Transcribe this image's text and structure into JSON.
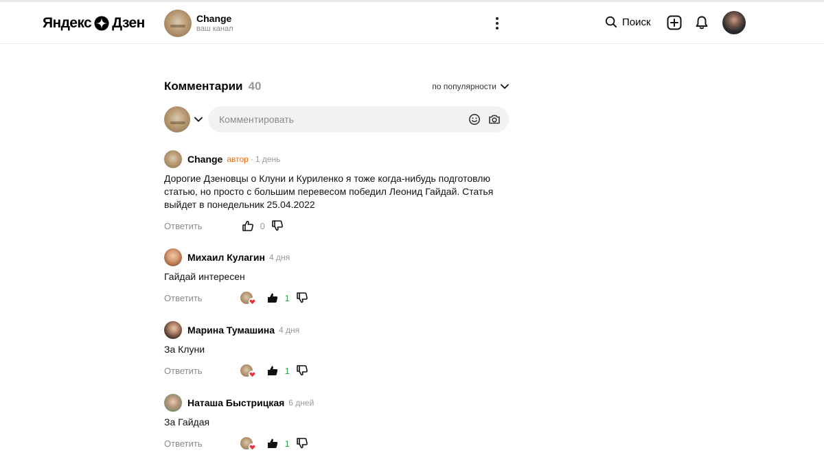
{
  "header": {
    "logo_text_1": "Яндекс",
    "logo_text_2": "Дзен",
    "channel_name": "Change",
    "channel_sub": "ваш канал",
    "search_label": "Поиск"
  },
  "comments": {
    "title": "Комментарии",
    "count": "40",
    "sort_label": "по популярности",
    "input_placeholder": "Комментировать",
    "items": [
      {
        "author": "Change",
        "badge": "автор",
        "separator": "·",
        "time": "1 день",
        "text": "Дорогие Дзеновцы о Клуни и Куриленко я тоже когда-нибудь подготовлю статью, но просто с большим перевесом победил Леонид Гайдай. Статья выйдет в понедельник 25.04.2022",
        "reply_label": "Ответить",
        "likes": "0"
      },
      {
        "author": "Михаил Кулагин",
        "time": "4 дня",
        "text": "Гайдай интересен",
        "reply_label": "Ответить",
        "likes": "1"
      },
      {
        "author": "Марина Тумашина",
        "time": "4 дня",
        "text": "За Клуни",
        "reply_label": "Ответить",
        "likes": "1"
      },
      {
        "author": "Наташа Быстрицкая",
        "time": "6 дней",
        "text": "За Гайдая",
        "reply_label": "Ответить",
        "likes": "1"
      }
    ]
  },
  "colors": {
    "author_badge": "#ff6a00",
    "positive_count": "#2fa84f",
    "input_bg": "#f2f2f2"
  },
  "icons": [
    "zen-star-icon",
    "kebab-menu-icon",
    "search-icon",
    "plus-icon",
    "bell-icon",
    "chevron-down-icon",
    "emoji-icon",
    "camera-icon",
    "thumb-up-icon",
    "thumb-down-icon",
    "heart-icon"
  ]
}
